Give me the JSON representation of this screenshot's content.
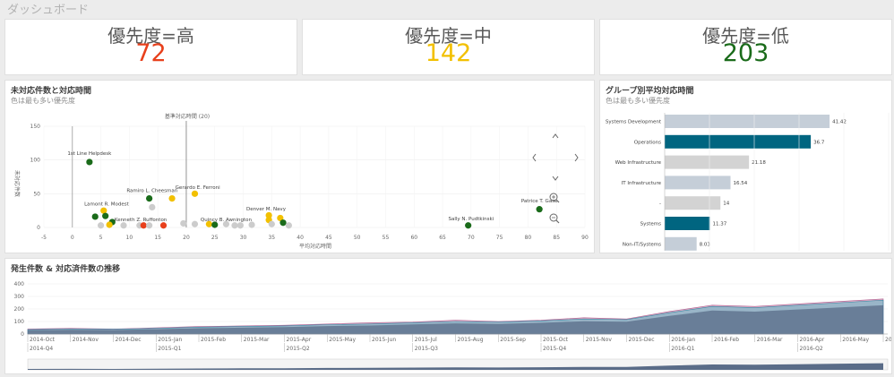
{
  "page_title": "ダッシュボード",
  "kpis": [
    {
      "label": "優先度=高",
      "value": "72",
      "color": "#e8401c"
    },
    {
      "label": "優先度=中",
      "value": "142",
      "color": "#f2c000"
    },
    {
      "label": "優先度=低",
      "value": "203",
      "color": "#1a6b1a"
    }
  ],
  "scatter": {
    "title": "未対応件数と対応時間",
    "subtitle": "色は最も多い優先度",
    "ref_label": "基準対応時間 (20)",
    "ylabel": "未対応件数",
    "xlabel": "平均対応時間",
    "x_ticks": [
      "-5",
      "0",
      "5",
      "10",
      "15",
      "20",
      "25",
      "30",
      "35",
      "40",
      "45",
      "50",
      "55",
      "60",
      "65",
      "70",
      "75",
      "80",
      "85",
      "90"
    ],
    "y_ticks": [
      "0",
      "50",
      "100",
      "150"
    ],
    "labels": [
      {
        "text": "1st Line Helpdesk",
        "x": 3,
        "y": 110
      },
      {
        "text": "Ramiro L. Cheesman",
        "x": 14,
        "y": 55
      },
      {
        "text": "Gerardo E. Ferroni",
        "x": 22,
        "y": 60
      },
      {
        "text": "Lamont R. Modest",
        "x": 6,
        "y": 35
      },
      {
        "text": "Denver M. Navy",
        "x": 34,
        "y": 28
      },
      {
        "text": "Kenneth Z. Ruffonton",
        "x": 12,
        "y": 12
      },
      {
        "text": "Quincy B. Awnington",
        "x": 27,
        "y": 12
      },
      {
        "text": "Sally N. Pudtkinski",
        "x": 70,
        "y": 13
      },
      {
        "text": "Patrice T. Gase",
        "x": 82,
        "y": 40
      }
    ]
  },
  "bars": {
    "title": "グループ別平均対応時間",
    "subtitle": "色は最も多い優先度",
    "items": [
      {
        "name": "Systems Development",
        "value": "41.42",
        "num": 41.42,
        "color": "#c5ced8"
      },
      {
        "name": "Operations",
        "value": "36.7",
        "num": 36.7,
        "color": "#006580"
      },
      {
        "name": "Web Infrastructure",
        "value": "21.18",
        "num": 21.18,
        "color": "#d3d3d3"
      },
      {
        "name": "IT Infrastructure",
        "value": "16.54",
        "num": 16.54,
        "color": "#c5ced8"
      },
      {
        "name": "-",
        "value": "14",
        "num": 14,
        "color": "#d3d3d3"
      },
      {
        "name": "Systems",
        "value": "11.37",
        "num": 11.37,
        "color": "#006580"
      },
      {
        "name": "Non-IT/Systems",
        "value": "8.03",
        "num": 8.03,
        "color": "#c5ced8"
      }
    ]
  },
  "trend": {
    "title": "発生件数 & 対応済件数の推移",
    "y_ticks": [
      "0",
      "100",
      "200",
      "300",
      "400"
    ],
    "months": [
      "2014-Oct",
      "2014-Nov",
      "2014-Dec",
      "2015-Jan",
      "2015-Feb",
      "2015-Mar",
      "2015-Apr",
      "2015-May",
      "2015-Jun",
      "2015-Jul",
      "2015-Aug",
      "2015-Sep",
      "2015-Oct",
      "2015-Nov",
      "2015-Dec",
      "2016-Jan",
      "2016-Feb",
      "2016-Mar",
      "2016-Apr",
      "2016-May",
      "2016-Jun"
    ],
    "quarters": [
      "2014-Q4",
      "2015-Q1",
      "2015-Q2",
      "2015-Q3",
      "2015-Q4",
      "2016-Q1",
      "2016-Q2"
    ]
  },
  "chart_data": [
    {
      "type": "scatter",
      "title": "未対応件数と対応時間",
      "xlabel": "平均対応時間",
      "ylabel": "未対応件数",
      "xlim": [
        -5,
        90
      ],
      "ylim": [
        0,
        150
      ],
      "reference_line": {
        "x": 20,
        "label": "基準対応時間 (20)"
      },
      "points": [
        {
          "x": 3,
          "y": 97,
          "color": "#1a6b1a"
        },
        {
          "x": 13.5,
          "y": 43,
          "color": "#1a6b1a"
        },
        {
          "x": 17.5,
          "y": 43,
          "color": "#f2c000"
        },
        {
          "x": 21.5,
          "y": 50,
          "color": "#f2c000"
        },
        {
          "x": 14,
          "y": 30,
          "color": "#cccccc"
        },
        {
          "x": 5.5,
          "y": 25,
          "color": "#f2c000"
        },
        {
          "x": 4,
          "y": 16,
          "color": "#1a6b1a"
        },
        {
          "x": 5.8,
          "y": 17,
          "color": "#1a6b1a"
        },
        {
          "x": 7,
          "y": 8,
          "color": "#1a6b1a"
        },
        {
          "x": 6.5,
          "y": 4,
          "color": "#f2c000"
        },
        {
          "x": 5,
          "y": 3,
          "color": "#cccccc"
        },
        {
          "x": 9,
          "y": 3,
          "color": "#cccccc"
        },
        {
          "x": 11.8,
          "y": 3,
          "color": "#cccccc"
        },
        {
          "x": 12.5,
          "y": 3,
          "color": "#e8401c"
        },
        {
          "x": 13.5,
          "y": 3,
          "color": "#cccccc"
        },
        {
          "x": 16,
          "y": 3,
          "color": "#e8401c"
        },
        {
          "x": 19.5,
          "y": 6,
          "color": "#cccccc"
        },
        {
          "x": 21.5,
          "y": 5,
          "color": "#cccccc"
        },
        {
          "x": 24,
          "y": 5,
          "color": "#f2c000"
        },
        {
          "x": 25,
          "y": 4,
          "color": "#1a6b1a"
        },
        {
          "x": 27,
          "y": 5,
          "color": "#cccccc"
        },
        {
          "x": 28.5,
          "y": 3,
          "color": "#cccccc"
        },
        {
          "x": 29.5,
          "y": 3,
          "color": "#cccccc"
        },
        {
          "x": 31.5,
          "y": 4,
          "color": "#cccccc"
        },
        {
          "x": 34.5,
          "y": 18,
          "color": "#f2c000"
        },
        {
          "x": 34.5,
          "y": 11,
          "color": "#f2c000"
        },
        {
          "x": 35,
          "y": 5,
          "color": "#cccccc"
        },
        {
          "x": 36.5,
          "y": 14,
          "color": "#f2c000"
        },
        {
          "x": 37,
          "y": 7,
          "color": "#1a6b1a"
        },
        {
          "x": 38,
          "y": 3,
          "color": "#cccccc"
        },
        {
          "x": 69.5,
          "y": 3,
          "color": "#1a6b1a"
        },
        {
          "x": 82,
          "y": 27,
          "color": "#1a6b1a"
        }
      ]
    },
    {
      "type": "bar",
      "title": "グループ別平均対応時間",
      "orientation": "horizontal",
      "categories": [
        "Systems Development",
        "Operations",
        "Web Infrastructure",
        "IT Infrastructure",
        "-",
        "Systems",
        "Non-IT/Systems"
      ],
      "values": [
        41.42,
        36.7,
        21.18,
        16.54,
        14,
        11.37,
        8.03
      ]
    },
    {
      "type": "area",
      "title": "発生件数 & 対応済件数の推移",
      "ylim": [
        0,
        400
      ],
      "x": [
        "2014-Oct",
        "2014-Nov",
        "2014-Dec",
        "2015-Jan",
        "2015-Feb",
        "2015-Mar",
        "2015-Apr",
        "2015-May",
        "2015-Jun",
        "2015-Jul",
        "2015-Aug",
        "2015-Sep",
        "2015-Oct",
        "2015-Nov",
        "2015-Dec",
        "2016-Jan",
        "2016-Feb",
        "2016-Mar",
        "2016-Apr",
        "2016-May",
        "2016-Jun"
      ],
      "series": [
        {
          "values": [
            40,
            45,
            40,
            50,
            60,
            65,
            70,
            80,
            90,
            95,
            110,
            100,
            110,
            130,
            120,
            180,
            230,
            220,
            240,
            260,
            280
          ],
          "color": "#d38fb0"
        },
        {
          "values": [
            35,
            40,
            38,
            45,
            55,
            60,
            65,
            75,
            80,
            90,
            100,
            95,
            105,
            120,
            115,
            170,
            220,
            210,
            230,
            250,
            270
          ],
          "color": "#7ab8c8"
        }
      ]
    }
  ]
}
